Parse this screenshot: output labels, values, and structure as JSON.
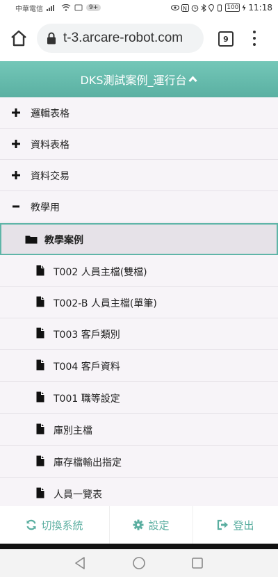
{
  "status_bar": {
    "carrier": "中華電信",
    "notif_count": "9+",
    "battery": "100",
    "time": "11:18"
  },
  "browser": {
    "url": "t-3.arcare-robot.com",
    "tab_count": "9"
  },
  "header": {
    "title": "DKS測試案例_運行台"
  },
  "tree": {
    "items": [
      {
        "label": "邏輯表格",
        "icon": "plus-icon",
        "level": 0
      },
      {
        "label": "資料表格",
        "icon": "plus-icon",
        "level": 0
      },
      {
        "label": "資料交易",
        "icon": "plus-icon",
        "level": 0
      },
      {
        "label": "教學用",
        "icon": "minus-icon",
        "level": 0
      },
      {
        "label": "教學案例",
        "icon": "folder-icon",
        "level": 1,
        "selected": true
      },
      {
        "label": "T002 人員主檔(雙檔)",
        "icon": "file-icon",
        "level": 2
      },
      {
        "label": "T002-B 人員主檔(單筆)",
        "icon": "file-icon",
        "level": 2
      },
      {
        "label": "T003 客戶類別",
        "icon": "file-icon",
        "level": 2
      },
      {
        "label": "T004 客戶資料",
        "icon": "file-icon",
        "level": 2
      },
      {
        "label": "T001 職等設定",
        "icon": "file-icon",
        "level": 2
      },
      {
        "label": "庫別主檔",
        "icon": "file-icon",
        "level": 2
      },
      {
        "label": "庫存檔輸出指定",
        "icon": "file-icon",
        "level": 2
      },
      {
        "label": "人員一覽表",
        "icon": "file-icon",
        "level": 2
      }
    ]
  },
  "footer": {
    "switch_label": "切換系統",
    "settings_label": "設定",
    "logout_label": "登出"
  },
  "colors": {
    "accent": "#5aaea0",
    "header_top": "#74c7b8",
    "header_bottom": "#5ab0a2",
    "list_bg": "#f7f4f8"
  }
}
